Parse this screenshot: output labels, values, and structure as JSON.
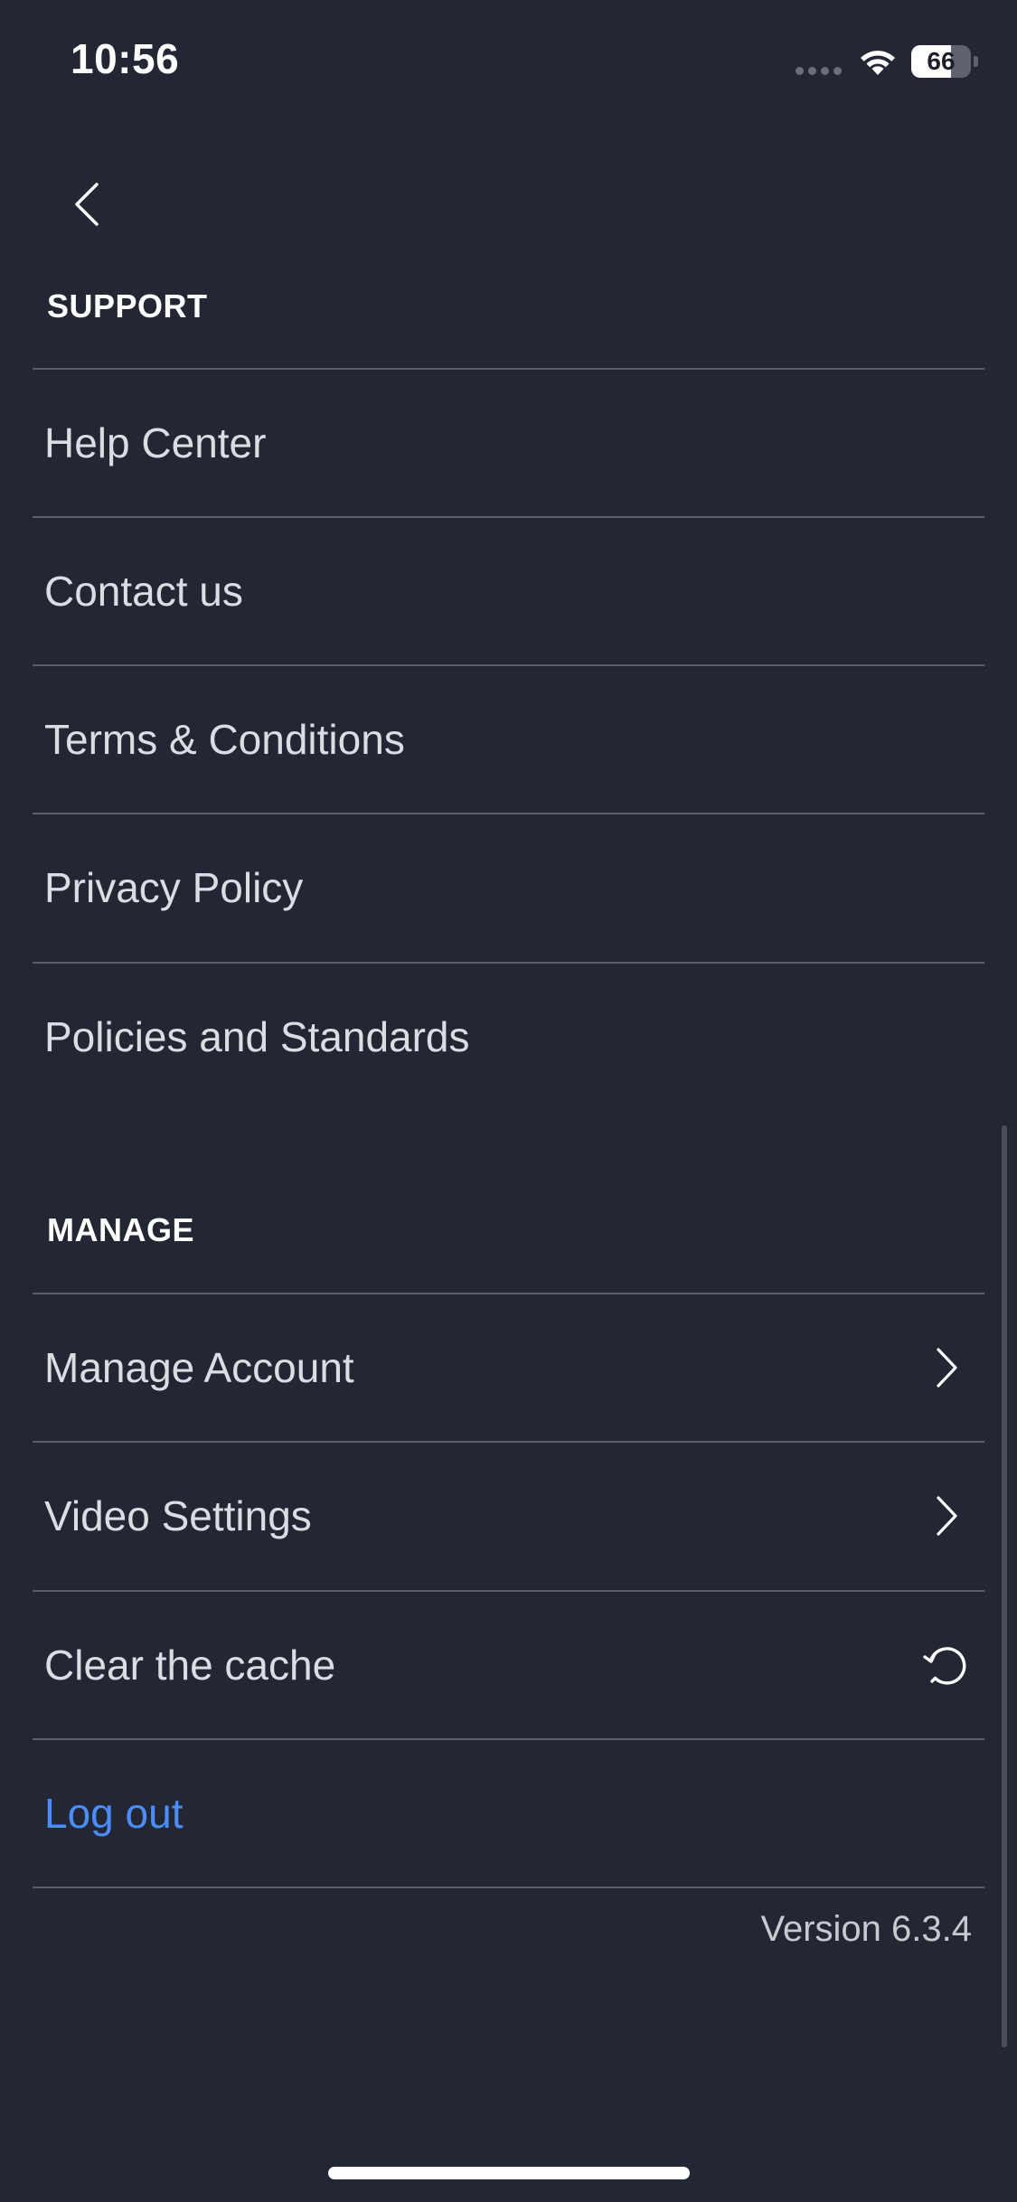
{
  "status_bar": {
    "time": "10:56",
    "battery_level": "66",
    "battery_fraction": 0.66,
    "wifi_icon": "wifi-icon",
    "signal_icon": "cellular-signal-icon"
  },
  "nav": {
    "back_icon": "chevron-left-icon"
  },
  "support": {
    "header": "SUPPORT",
    "items": [
      {
        "label": "Help Center"
      },
      {
        "label": "Contact us"
      },
      {
        "label": "Terms & Conditions"
      },
      {
        "label": "Privacy Policy"
      },
      {
        "label": "Policies and Standards"
      }
    ]
  },
  "manage": {
    "header": "MANAGE",
    "items": [
      {
        "label": "Manage Account",
        "trailing_icon": "chevron-right-icon"
      },
      {
        "label": "Video Settings",
        "trailing_icon": "chevron-right-icon"
      },
      {
        "label": "Clear the cache",
        "trailing_icon": "refresh-icon"
      },
      {
        "label": "Log out"
      }
    ]
  },
  "footer": {
    "version": "Version 6.3.4"
  },
  "colors": {
    "background": "#232733",
    "divider": "#5b5f6b",
    "text": "#dcdde2",
    "logout": "#4c8dfc"
  }
}
